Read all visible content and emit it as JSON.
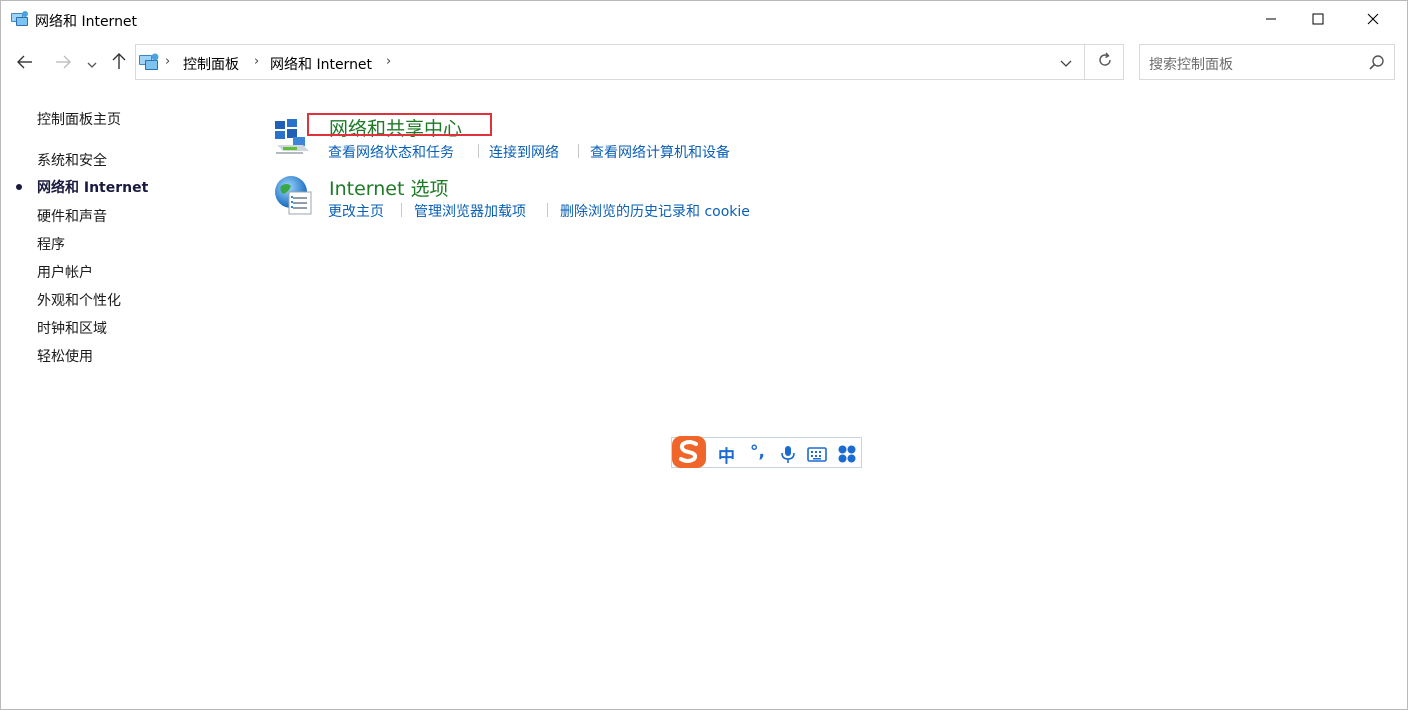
{
  "window": {
    "title": "网络和 Internet"
  },
  "titlebar_icons": [
    "network-folder-icon",
    "minimize-icon",
    "maximize-icon",
    "close-icon"
  ],
  "address_bar": {
    "breadcrumbs": [
      "控制面板",
      "网络和 Internet"
    ],
    "search_placeholder": "搜索控制面板"
  },
  "sidebar": {
    "items": [
      {
        "label": "控制面板主页",
        "active": false
      },
      {
        "label": "系统和安全",
        "active": false
      },
      {
        "label": "网络和 Internet",
        "active": true
      },
      {
        "label": "硬件和声音",
        "active": false
      },
      {
        "label": "程序",
        "active": false
      },
      {
        "label": "用户帐户",
        "active": false
      },
      {
        "label": "外观和个性化",
        "active": false
      },
      {
        "label": "时钟和区域",
        "active": false
      },
      {
        "label": "轻松使用",
        "active": false
      }
    ]
  },
  "categories": [
    {
      "title": "网络和共享中心",
      "icon": "network-sharing-center-icon",
      "links": [
        "查看网络状态和任务",
        "连接到网络",
        "查看网络计算机和设备"
      ]
    },
    {
      "title": "Internet 选项",
      "icon": "internet-options-globe-icon",
      "links": [
        "更改主页",
        "管理浏览器加载项",
        "删除浏览的历史记录和 cookie"
      ]
    }
  ],
  "ime_toolbar": {
    "mode_label": "中",
    "punct_label": "°,",
    "icons": [
      "sogou-logo-icon",
      "microphone-icon",
      "keyboard-icon",
      "toolbox-icon"
    ]
  },
  "colors": {
    "category_title": "#1e7a26",
    "link": "#0a5fb5",
    "highlight_border": "#e0323a",
    "ime_accent": "#1b6bd1",
    "sogou_orange": "#f0652a"
  }
}
